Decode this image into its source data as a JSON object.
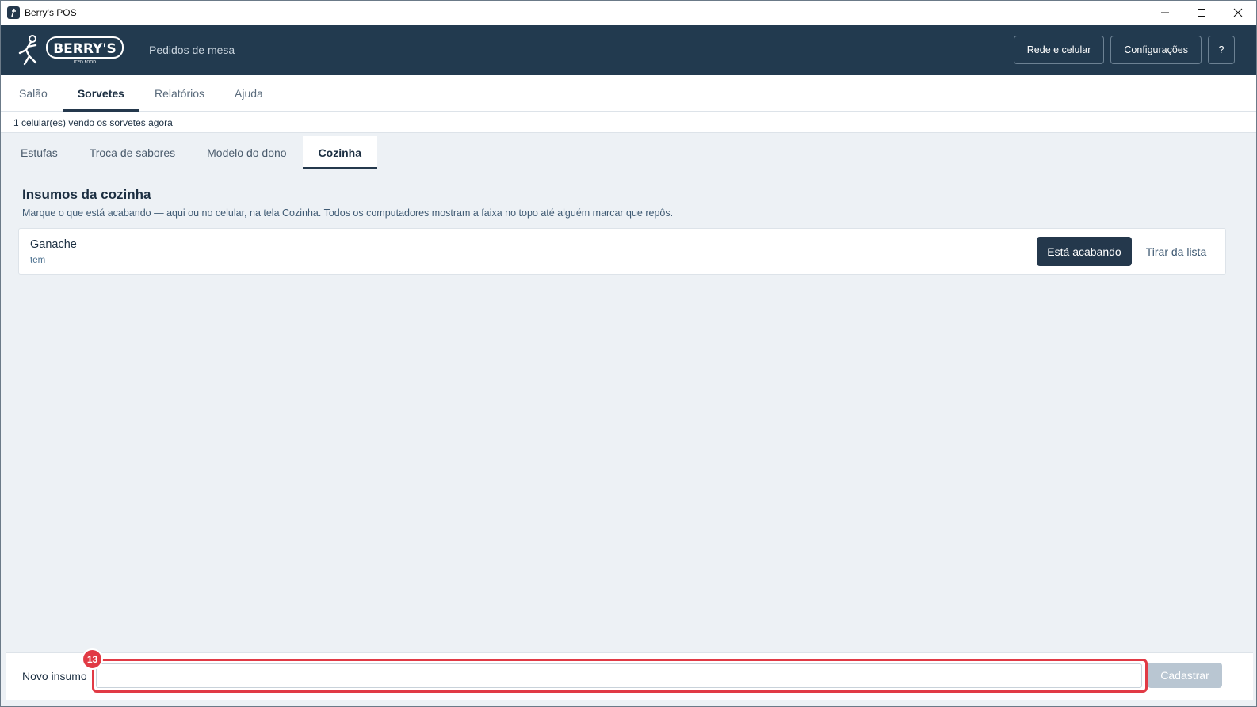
{
  "window": {
    "title": "Berry's POS",
    "controls": [
      "minimize-icon",
      "maximize-icon",
      "close-icon"
    ]
  },
  "header": {
    "logo_text": "BERRY'S",
    "logo_subtext": "ICED FOOD",
    "subtitle": "Pedidos de mesa",
    "actions": {
      "network": "Rede e celular",
      "settings": "Configurações",
      "help": "?"
    }
  },
  "main_tabs": [
    {
      "label": "Salão",
      "active": false
    },
    {
      "label": "Sorvetes",
      "active": true
    },
    {
      "label": "Relatórios",
      "active": false
    },
    {
      "label": "Ajuda",
      "active": false
    }
  ],
  "status": "1 celular(es) vendo os sorvetes agora",
  "sub_tabs": [
    {
      "label": "Estufas",
      "active": false
    },
    {
      "label": "Troca de sabores",
      "active": false
    },
    {
      "label": "Modelo do dono",
      "active": false
    },
    {
      "label": "Cozinha",
      "active": true
    }
  ],
  "section": {
    "title": "Insumos da cozinha",
    "description": "Marque o que está acabando — aqui ou no celular, na tela Cozinha. Todos os computadores mostram a faixa no topo até alguém marcar que repôs."
  },
  "items": [
    {
      "name": "Ganache",
      "status": "tem",
      "primary_action": "Está acabando",
      "secondary_action": "Tirar da lista"
    }
  ],
  "footer": {
    "label": "Novo insumo",
    "input_value": "",
    "submit": "Cadastrar",
    "highlight_badge": "13"
  },
  "colors": {
    "header_bg": "#223a4f",
    "accent": "#24384c",
    "highlight": "#e13a45",
    "disabled_button": "#b9c6d2"
  }
}
